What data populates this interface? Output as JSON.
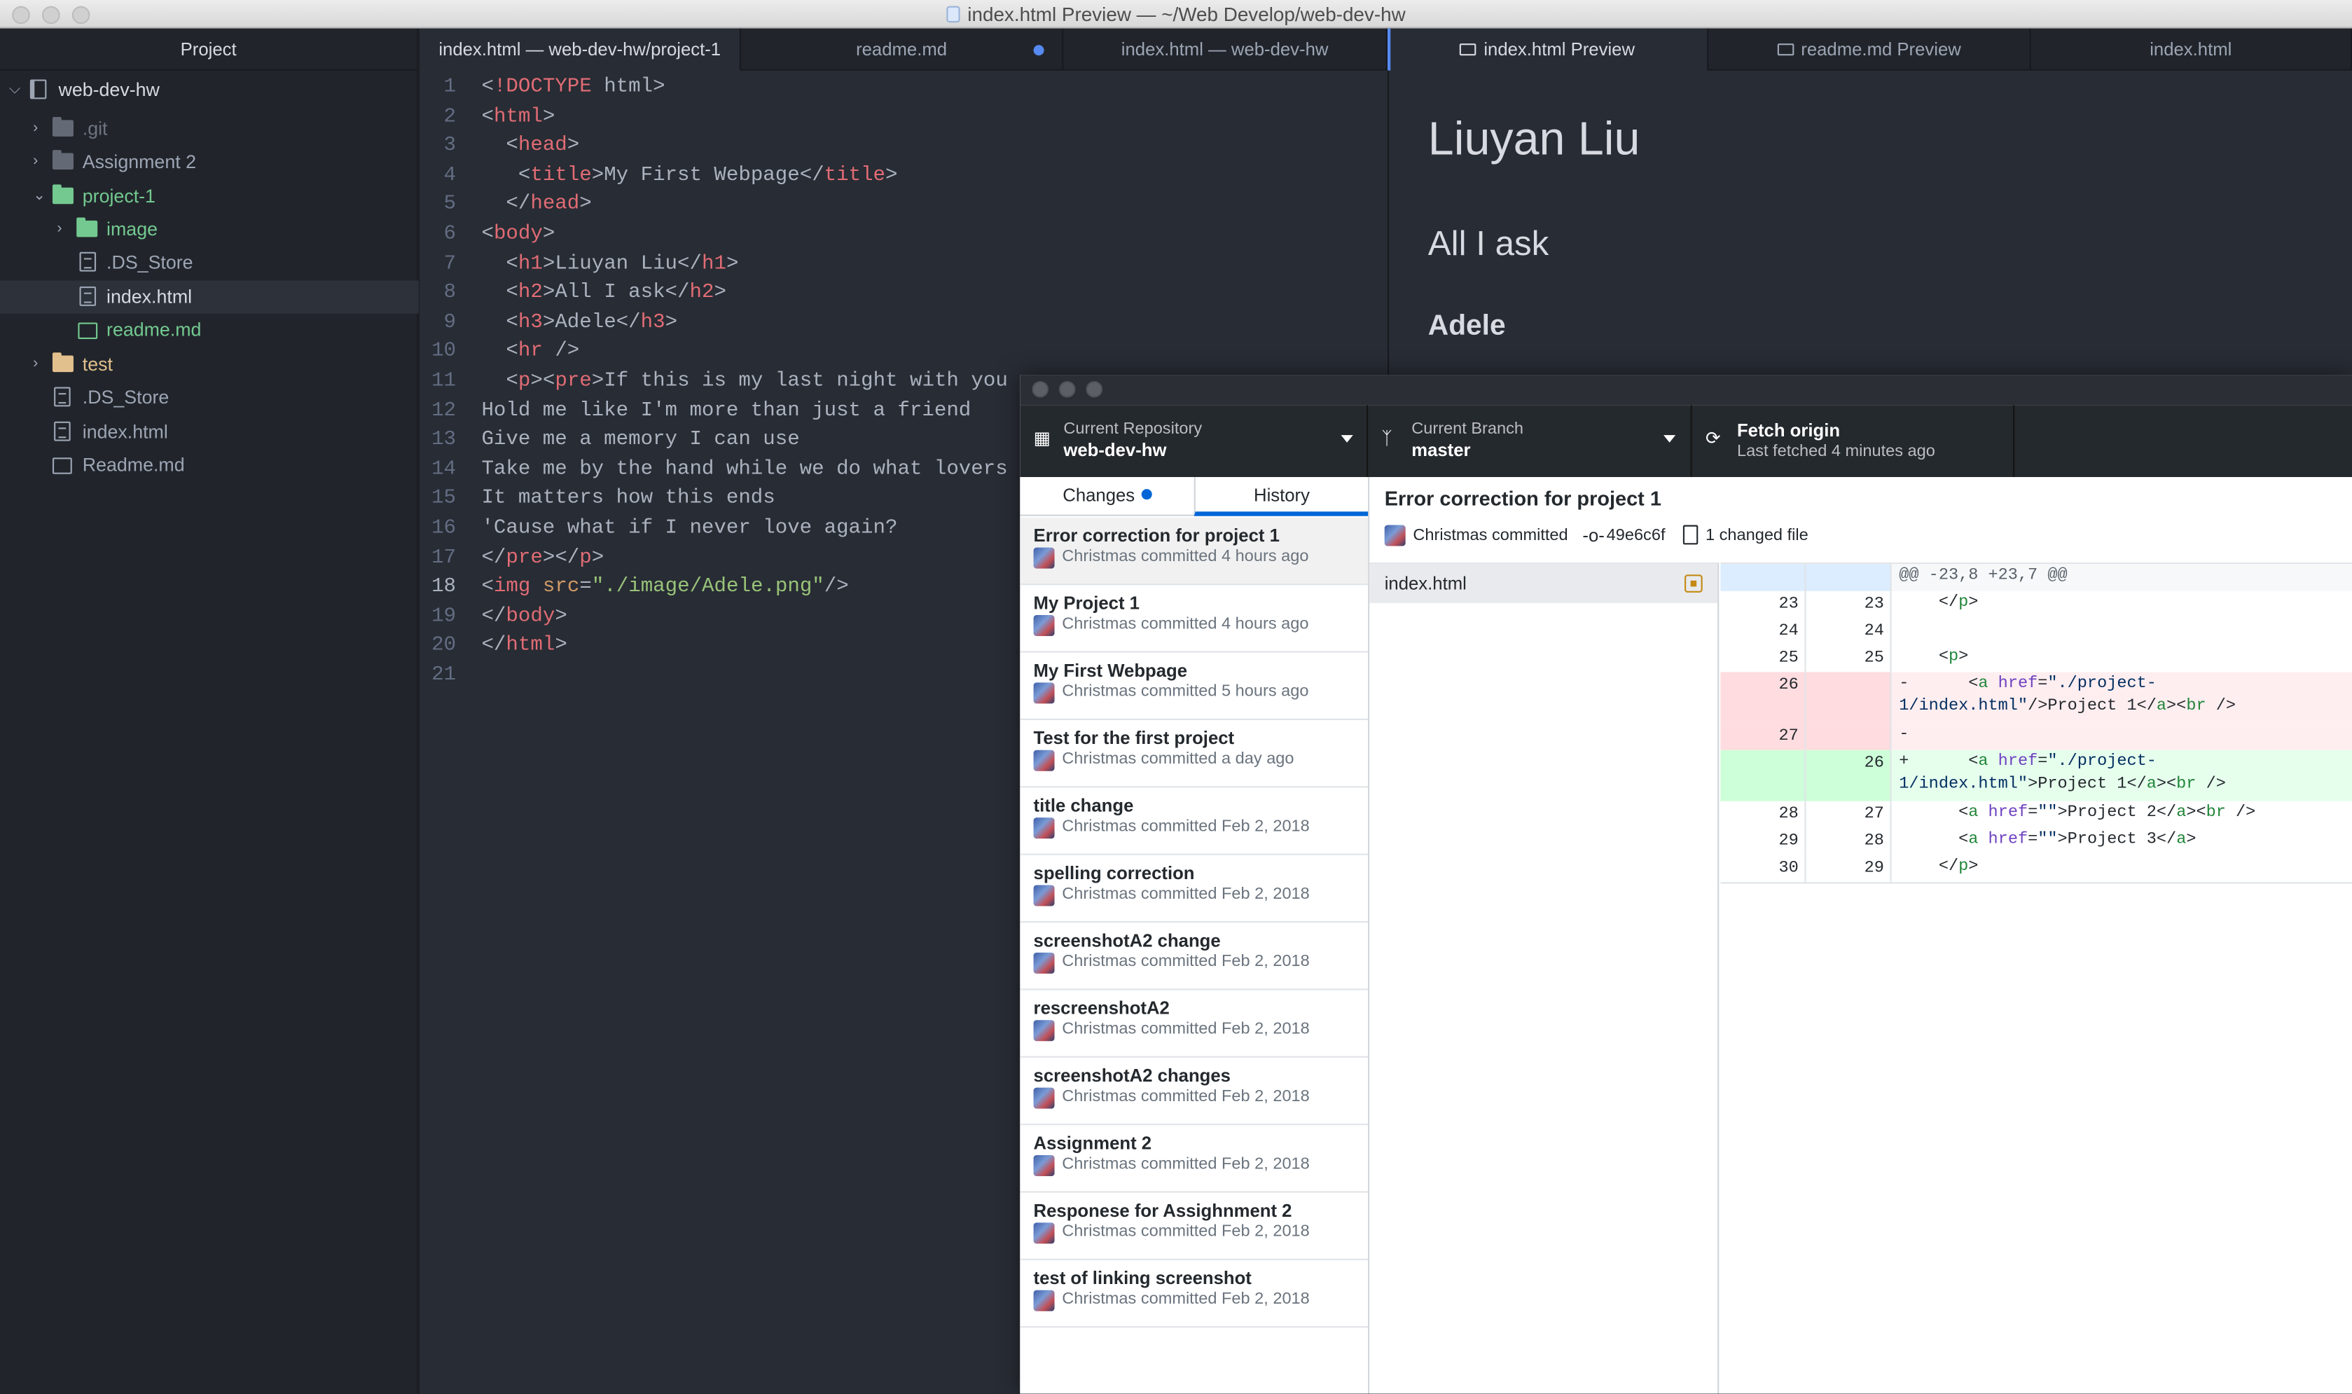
{
  "window": {
    "title": "index.html Preview — ~/Web Develop/web-dev-hw"
  },
  "tree": {
    "header": "Project",
    "items": [
      {
        "label": "web-dev-hw",
        "kind": "repo",
        "arrow": "v"
      },
      {
        "label": ".git",
        "kind": "folder",
        "arrow": ">"
      },
      {
        "label": "Assignment 2",
        "kind": "folder",
        "arrow": ">"
      },
      {
        "label": "project-1",
        "kind": "folder-green",
        "arrow": "v"
      },
      {
        "label": "image",
        "kind": "folder-green",
        "arrow": ">"
      },
      {
        "label": ".DS_Store",
        "kind": "file"
      },
      {
        "label": "index.html",
        "kind": "file"
      },
      {
        "label": "readme.md",
        "kind": "md-green"
      },
      {
        "label": "test",
        "kind": "folder-yellow",
        "arrow": ">"
      },
      {
        "label": ".DS_Store",
        "kind": "file"
      },
      {
        "label": "index.html",
        "kind": "file"
      },
      {
        "label": "Readme.md",
        "kind": "md"
      }
    ]
  },
  "tabs": [
    "index.html — web-dev-hw/project-1",
    "readme.md",
    "index.html — web-dev-hw",
    "index.html Preview",
    "readme.md Preview",
    "index.html"
  ],
  "editor": {
    "lines": [
      "<!DOCTYPE html>",
      "<html>",
      "  <head>",
      "   <title>My First Webpage</title>",
      "  </head>",
      "<body>",
      "  <h1>Liuyan Liu</h1>",
      "  <h2>All I ask</h2>",
      "  <h3>Adele</h3>",
      "  <hr />",
      "  <p><pre>If this is my last night with you",
      "Hold me like I'm more than just a friend",
      "Give me a memory I can use",
      "Take me by the hand while we do what lovers do",
      "It matters how this ends",
      "'Cause what if I never love again?",
      "</pre></p>",
      "<img src=\"./image/Adele.png\"/>",
      "</body>",
      "</html>",
      ""
    ]
  },
  "preview": {
    "h1": "Liuyan Liu",
    "h2": "All I ask",
    "h3": "Adele"
  },
  "github": {
    "repo_label": "Current Repository",
    "repo_value": "web-dev-hw",
    "branch_label": "Current Branch",
    "branch_value": "master",
    "fetch_label": "Fetch origin",
    "fetch_sub": "Last fetched 4 minutes ago",
    "tab_changes": "Changes",
    "tab_history": "History",
    "commits": [
      {
        "title": "Error correction for project 1",
        "meta": "Christmas committed 4 hours ago"
      },
      {
        "title": "My Project 1",
        "meta": "Christmas committed 4 hours ago"
      },
      {
        "title": "My First Webpage",
        "meta": "Christmas committed 5 hours ago"
      },
      {
        "title": "Test for the first project",
        "meta": "Christmas committed a day ago"
      },
      {
        "title": "title change",
        "meta": "Christmas committed Feb 2, 2018"
      },
      {
        "title": "spelling correction",
        "meta": "Christmas committed Feb 2, 2018"
      },
      {
        "title": "screenshotA2 change",
        "meta": "Christmas committed Feb 2, 2018"
      },
      {
        "title": "rescreenshotA2",
        "meta": "Christmas committed Feb 2, 2018"
      },
      {
        "title": "screenshotA2 changes",
        "meta": "Christmas committed Feb 2, 2018"
      },
      {
        "title": "Assignment 2",
        "meta": "Christmas committed Feb 2, 2018"
      },
      {
        "title": "Responese for Assighnment 2",
        "meta": "Christmas committed Feb 2, 2018"
      },
      {
        "title": "test of linking screenshot",
        "meta": "Christmas committed Feb 2, 2018"
      }
    ],
    "detail": {
      "title": "Error correction for project 1",
      "author": "Christmas committed",
      "sha": "49e6c6f",
      "files_changed": "1 changed file",
      "file": "index.html"
    },
    "diff": [
      {
        "type": "hunk",
        "old": "",
        "new": "",
        "text": "@@ -23,8 +23,7 @@"
      },
      {
        "type": "ctx",
        "old": "23",
        "new": "23",
        "text": "    </p>"
      },
      {
        "type": "ctx",
        "old": "24",
        "new": "24",
        "text": ""
      },
      {
        "type": "ctx",
        "old": "25",
        "new": "25",
        "text": "    <p>"
      },
      {
        "type": "del",
        "old": "26",
        "new": "",
        "text": "-      <a href=\"./project-1/index.html\"/>Project 1</a><br />"
      },
      {
        "type": "del",
        "old": "27",
        "new": "",
        "text": "-"
      },
      {
        "type": "add",
        "old": "",
        "new": "26",
        "text": "+      <a href=\"./project-1/index.html\">Project 1</a><br />"
      },
      {
        "type": "ctx",
        "old": "28",
        "new": "27",
        "text": "      <a href=\"\">Project 2</a><br />"
      },
      {
        "type": "ctx",
        "old": "29",
        "new": "28",
        "text": "      <a href=\"\">Project 3</a>"
      },
      {
        "type": "ctx",
        "old": "30",
        "new": "29",
        "text": "    </p>"
      }
    ]
  }
}
